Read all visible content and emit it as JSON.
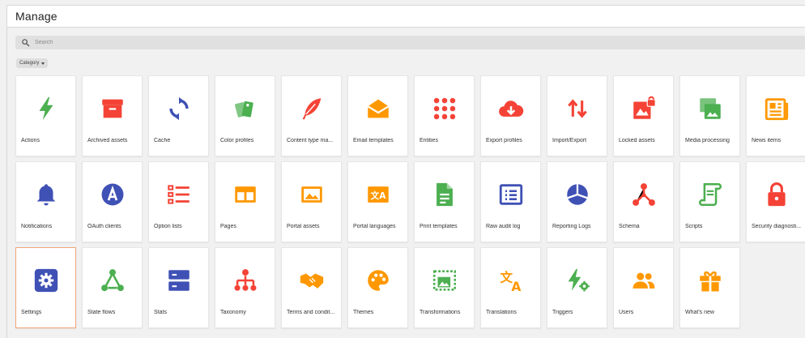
{
  "header": {
    "title": "Manage"
  },
  "search": {
    "placeholder": "Search"
  },
  "filter": {
    "category_label": "Category"
  },
  "colors": {
    "green": "#4caf50",
    "red": "#f44336",
    "blue": "#3f51b5",
    "orange": "#ff9800"
  },
  "tiles": [
    {
      "label": "Actions",
      "icon": "lightning-icon",
      "color": "#4caf50"
    },
    {
      "label": "Archived assets",
      "icon": "archive-box-icon",
      "color": "#f44336"
    },
    {
      "label": "Cache",
      "icon": "refresh-icon",
      "color": "#3f51b5"
    },
    {
      "label": "Color profiles",
      "icon": "color-swatches-icon",
      "color": "#4caf50"
    },
    {
      "label": "Content type ma...",
      "icon": "feather-icon",
      "color": "#f44336"
    },
    {
      "label": "Email templates",
      "icon": "envelope-open-icon",
      "color": "#ff9800"
    },
    {
      "label": "Entities",
      "icon": "dot-grid-icon",
      "color": "#f44336"
    },
    {
      "label": "Export profiles",
      "icon": "cloud-download-icon",
      "color": "#f44336"
    },
    {
      "label": "Import/Export",
      "icon": "up-down-arrows-icon",
      "color": "#f44336"
    },
    {
      "label": "Locked assets",
      "icon": "locked-image-icon",
      "color": "#f44336"
    },
    {
      "label": "Media processing",
      "icon": "image-stack-icon",
      "color": "#4caf50"
    },
    {
      "label": "News items",
      "icon": "newspaper-icon",
      "color": "#ff9800"
    },
    {
      "label": "Notifications",
      "icon": "bell-icon",
      "color": "#3f51b5"
    },
    {
      "label": "OAuth clients",
      "icon": "oauth-badge-icon",
      "color": "#3f51b5"
    },
    {
      "label": "Option lists",
      "icon": "list-icon",
      "color": "#f44336"
    },
    {
      "label": "Pages",
      "icon": "page-layout-icon",
      "color": "#ff9800"
    },
    {
      "label": "Portal assets",
      "icon": "image-frame-icon",
      "color": "#ff9800"
    },
    {
      "label": "Portal languages",
      "icon": "translate-card-icon",
      "color": "#ff9800"
    },
    {
      "label": "Print templates",
      "icon": "document-icon",
      "color": "#4caf50"
    },
    {
      "label": "Raw audit log",
      "icon": "list-box-icon",
      "color": "#3f51b5"
    },
    {
      "label": "Reporting Logs",
      "icon": "pie-chart-icon",
      "color": "#3f51b5"
    },
    {
      "label": "Schema",
      "icon": "hub-icon",
      "color": "#f44336"
    },
    {
      "label": "Scripts",
      "icon": "scroll-icon",
      "color": "#4caf50"
    },
    {
      "label": "Security diagnosti...",
      "icon": "padlock-icon",
      "color": "#f44336"
    },
    {
      "label": "Settings",
      "icon": "gear-icon",
      "color": "#3f51b5",
      "selected": true
    },
    {
      "label": "State flows",
      "icon": "state-flow-icon",
      "color": "#4caf50"
    },
    {
      "label": "Stats",
      "icon": "server-stack-icon",
      "color": "#3f51b5"
    },
    {
      "label": "Taxonomy",
      "icon": "hierarchy-icon",
      "color": "#f44336"
    },
    {
      "label": "Terms and condit...",
      "icon": "handshake-icon",
      "color": "#ff9800"
    },
    {
      "label": "Themes",
      "icon": "palette-icon",
      "color": "#ff9800"
    },
    {
      "label": "Transformations",
      "icon": "transform-image-icon",
      "color": "#4caf50"
    },
    {
      "label": "Translations",
      "icon": "translate-icon",
      "color": "#ff9800"
    },
    {
      "label": "Triggers",
      "icon": "lightning-gear-icon",
      "color": "#4caf50"
    },
    {
      "label": "Users",
      "icon": "users-icon",
      "color": "#ff9800"
    },
    {
      "label": "What's new",
      "icon": "gift-icon",
      "color": "#ff9800"
    }
  ]
}
